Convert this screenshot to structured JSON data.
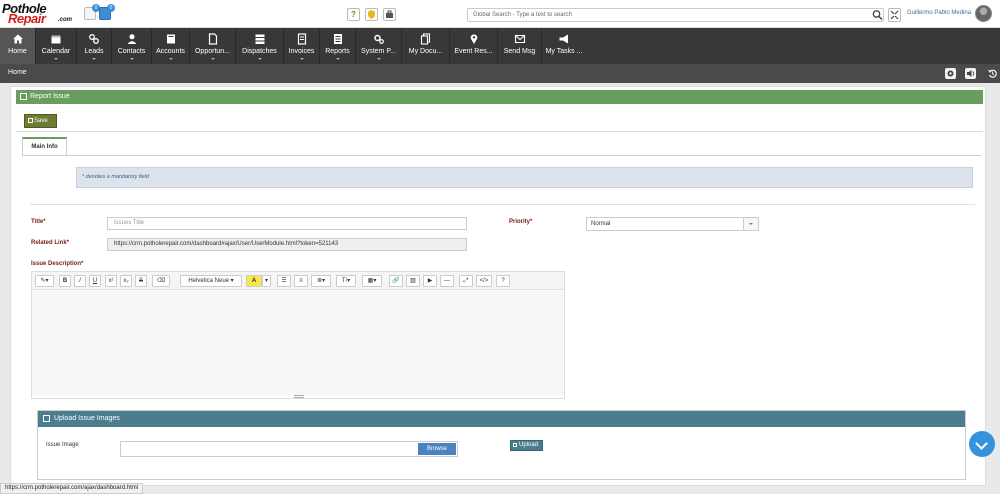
{
  "header": {
    "logo_line1": "Pothole",
    "logo_line2": "Repair",
    "logo_suffix": ".com",
    "badge1": "0",
    "badge2": "0",
    "help_label": "?",
    "search_placeholder": "Global Search - Type a text to search",
    "user_name": "Guillermo Pablo Medina"
  },
  "nav": {
    "items": [
      {
        "label": "Home",
        "icon": "home-icon"
      },
      {
        "label": "Calendar",
        "icon": "calendar-icon"
      },
      {
        "label": "Leads",
        "icon": "link-icon"
      },
      {
        "label": "Contacts",
        "icon": "user-icon"
      },
      {
        "label": "Accounts",
        "icon": "book-icon"
      },
      {
        "label": "Opportun...",
        "icon": "document-icon"
      },
      {
        "label": "Dispatches",
        "icon": "server-icon"
      },
      {
        "label": "Invoices",
        "icon": "invoice-icon"
      },
      {
        "label": "Reports",
        "icon": "report-icon"
      },
      {
        "label": "System P...",
        "icon": "gears-icon"
      },
      {
        "label": "My Docu...",
        "icon": "files-icon"
      },
      {
        "label": "Event Res...",
        "icon": "map-marker-icon"
      },
      {
        "label": "Send Msg",
        "icon": "envelope-icon"
      },
      {
        "label": "My Tasks ...",
        "icon": "megaphone-icon"
      }
    ]
  },
  "breadcrumb": {
    "home": "Home"
  },
  "report": {
    "title": "Report Issue",
    "save_label": "Save",
    "tab_main": "Main Info",
    "mandatory_note": "* denotes a mandatory field",
    "title_label": "Title*",
    "title_placeholder": "Issues Title",
    "related_label": "Related Link*",
    "related_value": "https://crm.potholerepair.com/dashboard#ajax/User/UserModule.html?token=521143",
    "priority_label": "Priority*",
    "priority_value": "Normal",
    "description_label": "Issue Description*"
  },
  "editor": {
    "font_name": "Helvetica Neue",
    "bold": "B",
    "italic": "I",
    "underline": "U",
    "superscript": "x²",
    "subscript": "x₂",
    "strike": "S",
    "color": "A",
    "height": "T⁞",
    "help": "?"
  },
  "upload": {
    "title": "Upload Issue Images",
    "image_label": "Issue Image",
    "browse_label": "Browse",
    "upload_label": "Upload"
  },
  "status_url": "https://crm.potholerepair.com/ajax/dashboard.html",
  "colors": {
    "nav_bg": "#383838",
    "report_header": "#6a9e60",
    "upload_header": "#4c7d8e",
    "save_button": "#6b7b31",
    "browse_button": "#4a83bf",
    "label_red": "#7a1a1a"
  }
}
